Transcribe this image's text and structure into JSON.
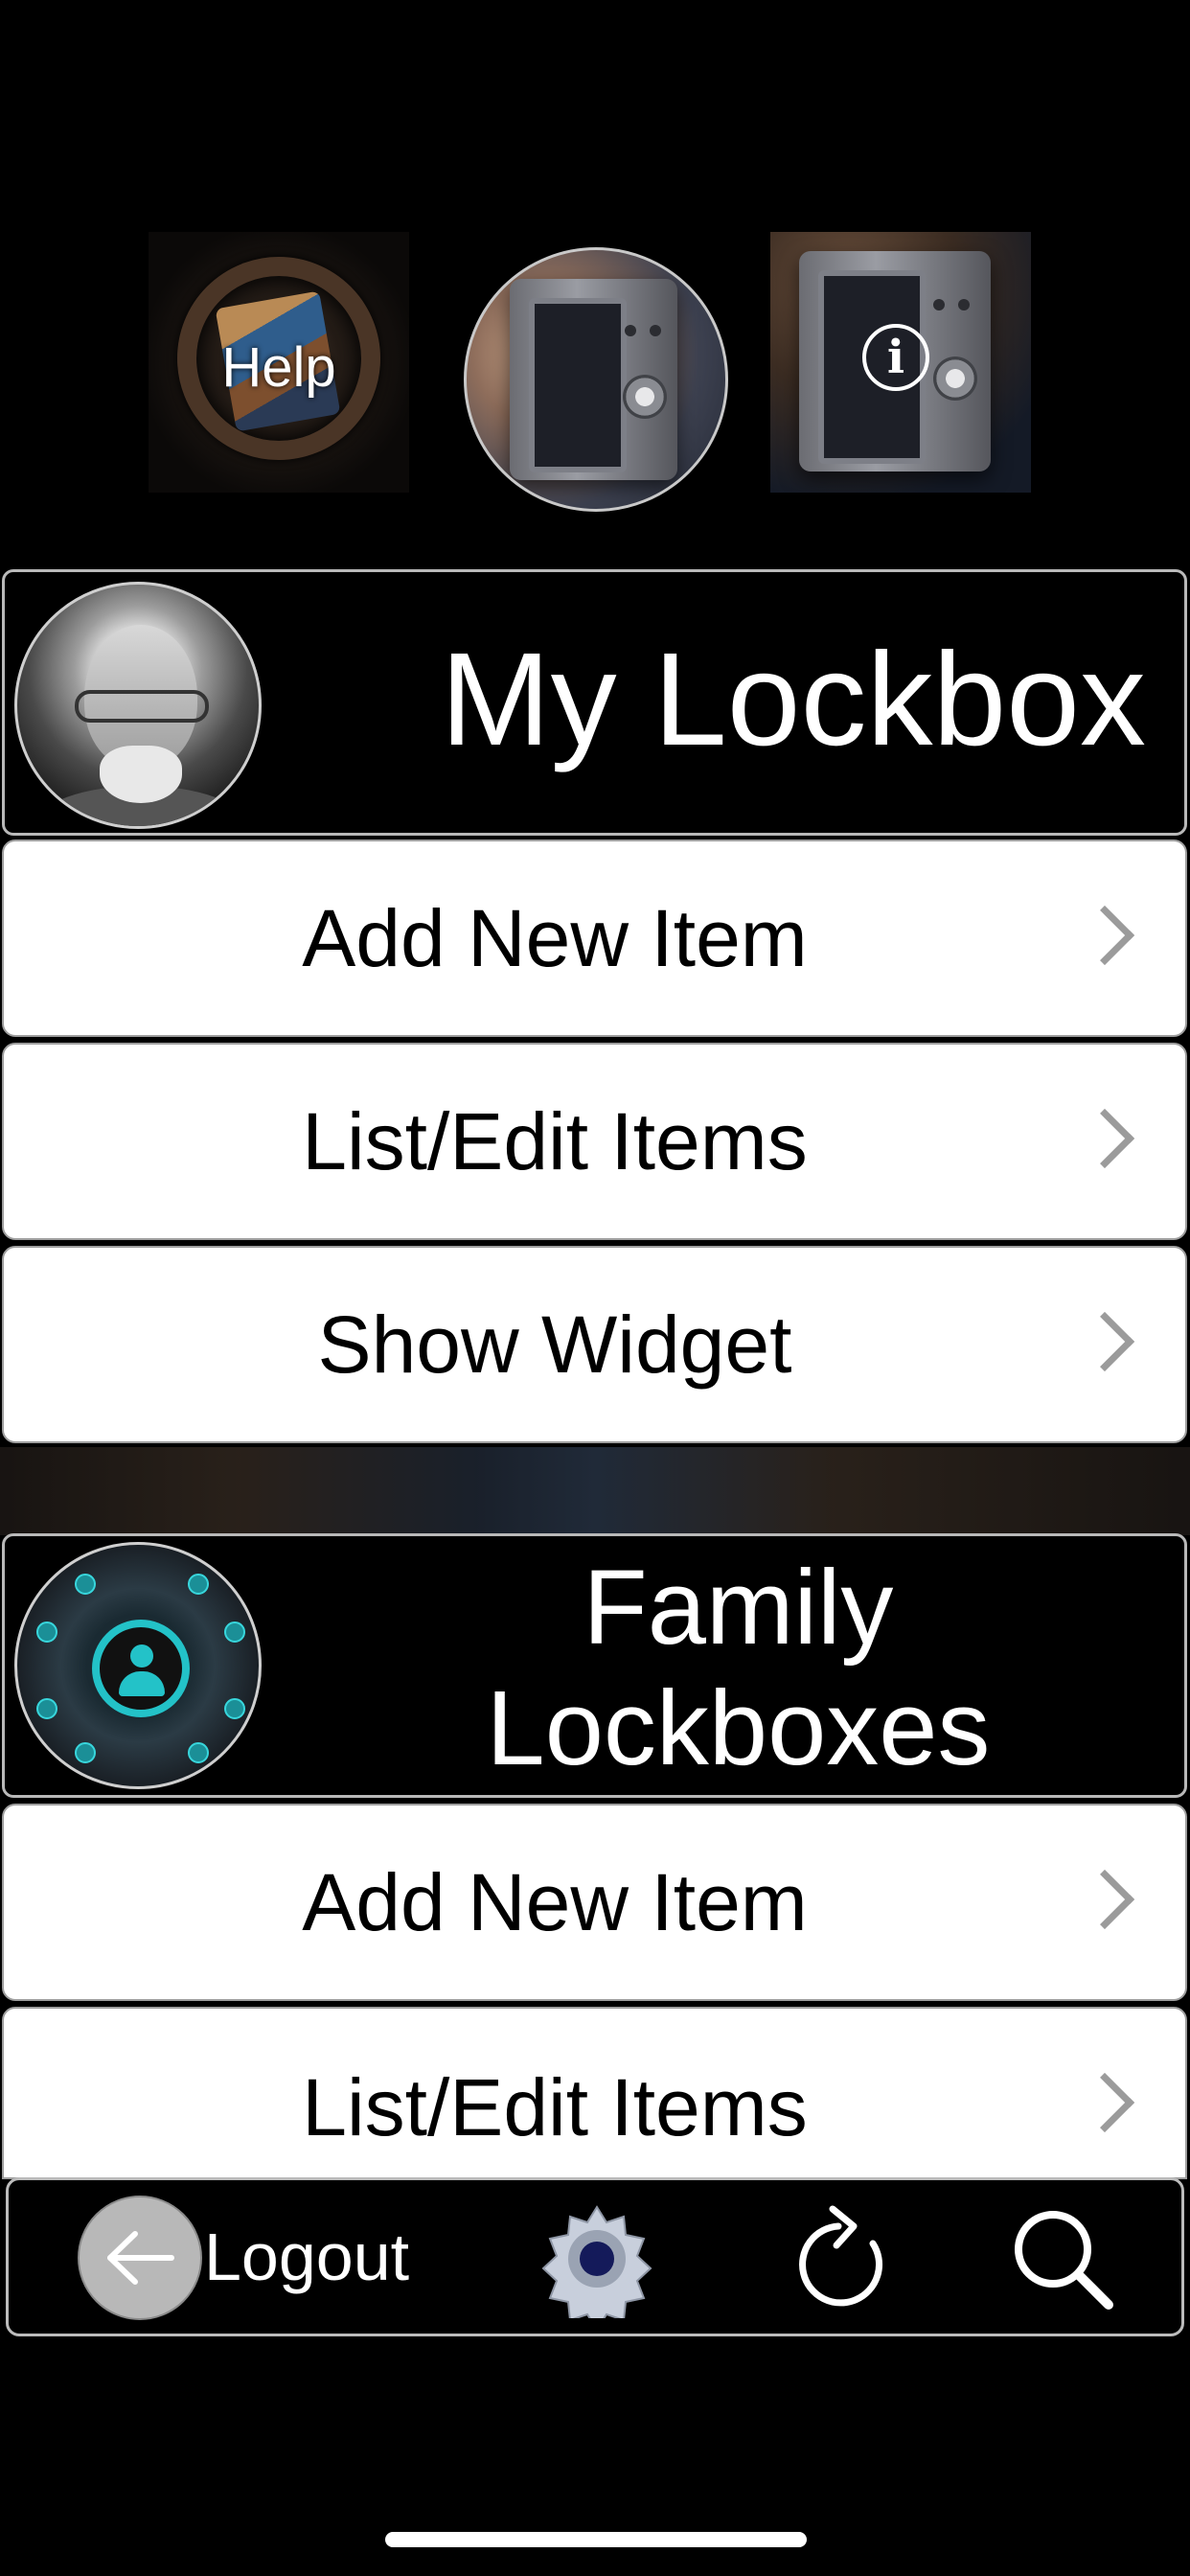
{
  "top_tiles": {
    "help_label": "Help"
  },
  "my_lockbox": {
    "title": "My Lockbox",
    "items": [
      {
        "label": "Add New Item"
      },
      {
        "label": "List/Edit Items"
      },
      {
        "label": "Show Widget"
      }
    ]
  },
  "family_lockboxes": {
    "title_line1": "Family",
    "title_line2": "Lockboxes",
    "items": [
      {
        "label": "Add New Item"
      },
      {
        "label": "List/Edit Items"
      }
    ]
  },
  "toolbar": {
    "logout_label": "Logout",
    "icons": [
      "arrow-left-icon",
      "gear-icon",
      "refresh-icon",
      "search-icon"
    ]
  },
  "colors": {
    "background": "#000000",
    "button_bg": "#ffffff",
    "chevron": "#9b9b9b",
    "family_accent": "#23c2c8"
  }
}
